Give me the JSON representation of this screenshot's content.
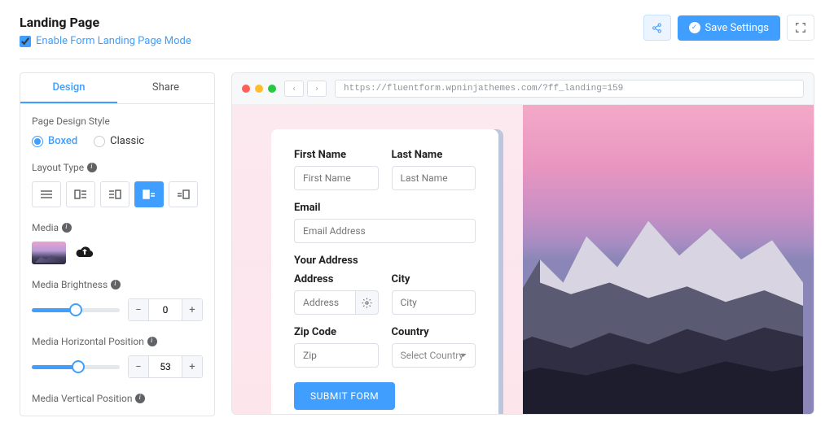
{
  "header": {
    "title": "Landing Page",
    "enable_label": "Enable Form Landing Page Mode",
    "save_label": "Save Settings"
  },
  "sidebar": {
    "tabs": {
      "design": "Design",
      "share": "Share"
    },
    "page_design_style": "Page Design Style",
    "boxed": "Boxed",
    "classic": "Classic",
    "layout_type": "Layout Type",
    "media": "Media",
    "media_brightness": "Media Brightness",
    "brightness_value": "0",
    "brightness_pct": 50,
    "media_horizontal": "Media Horizontal Position",
    "horizontal_value": "53",
    "horizontal_pct": 53,
    "media_vertical": "Media Vertical Position"
  },
  "preview": {
    "url": "https://fluentform.wpninjathemes.com/?ff_landing=159"
  },
  "form": {
    "first_name": {
      "label": "First Name",
      "placeholder": "First Name"
    },
    "last_name": {
      "label": "Last Name",
      "placeholder": "Last Name"
    },
    "email": {
      "label": "Email",
      "placeholder": "Email Address"
    },
    "address_section": "Your Address",
    "address": {
      "label": "Address",
      "placeholder": "Address"
    },
    "city": {
      "label": "City",
      "placeholder": "City"
    },
    "zip": {
      "label": "Zip Code",
      "placeholder": "Zip"
    },
    "country": {
      "label": "Country",
      "placeholder": "Select Country"
    },
    "submit": "SUBMIT FORM"
  }
}
